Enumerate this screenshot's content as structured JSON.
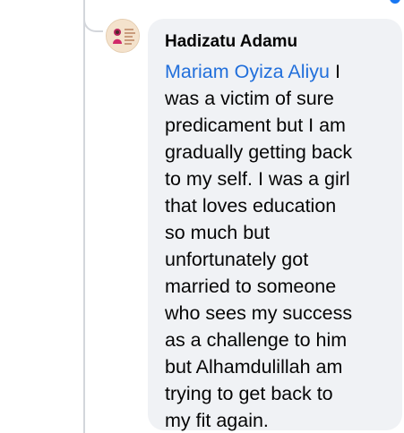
{
  "comment": {
    "author": "Hadizatu Adamu",
    "mention": "Mariam Oyiza Aliyu",
    "text_lines": [
      " I",
      "was a victim of sure",
      "predicament but I am",
      "gradually getting back",
      "to my self. I was a girl",
      "that loves education",
      "so much but",
      "unfortunately got",
      "married to someone",
      "who sees my success",
      "as a challenge to him",
      "but Alhamdulillah  am",
      "trying to get back to",
      "my fit again."
    ],
    "colors": {
      "bubble": "#f0f2f5",
      "mention": "#216fdb",
      "text": "#050505",
      "thread_line": "#d3d6db"
    }
  }
}
